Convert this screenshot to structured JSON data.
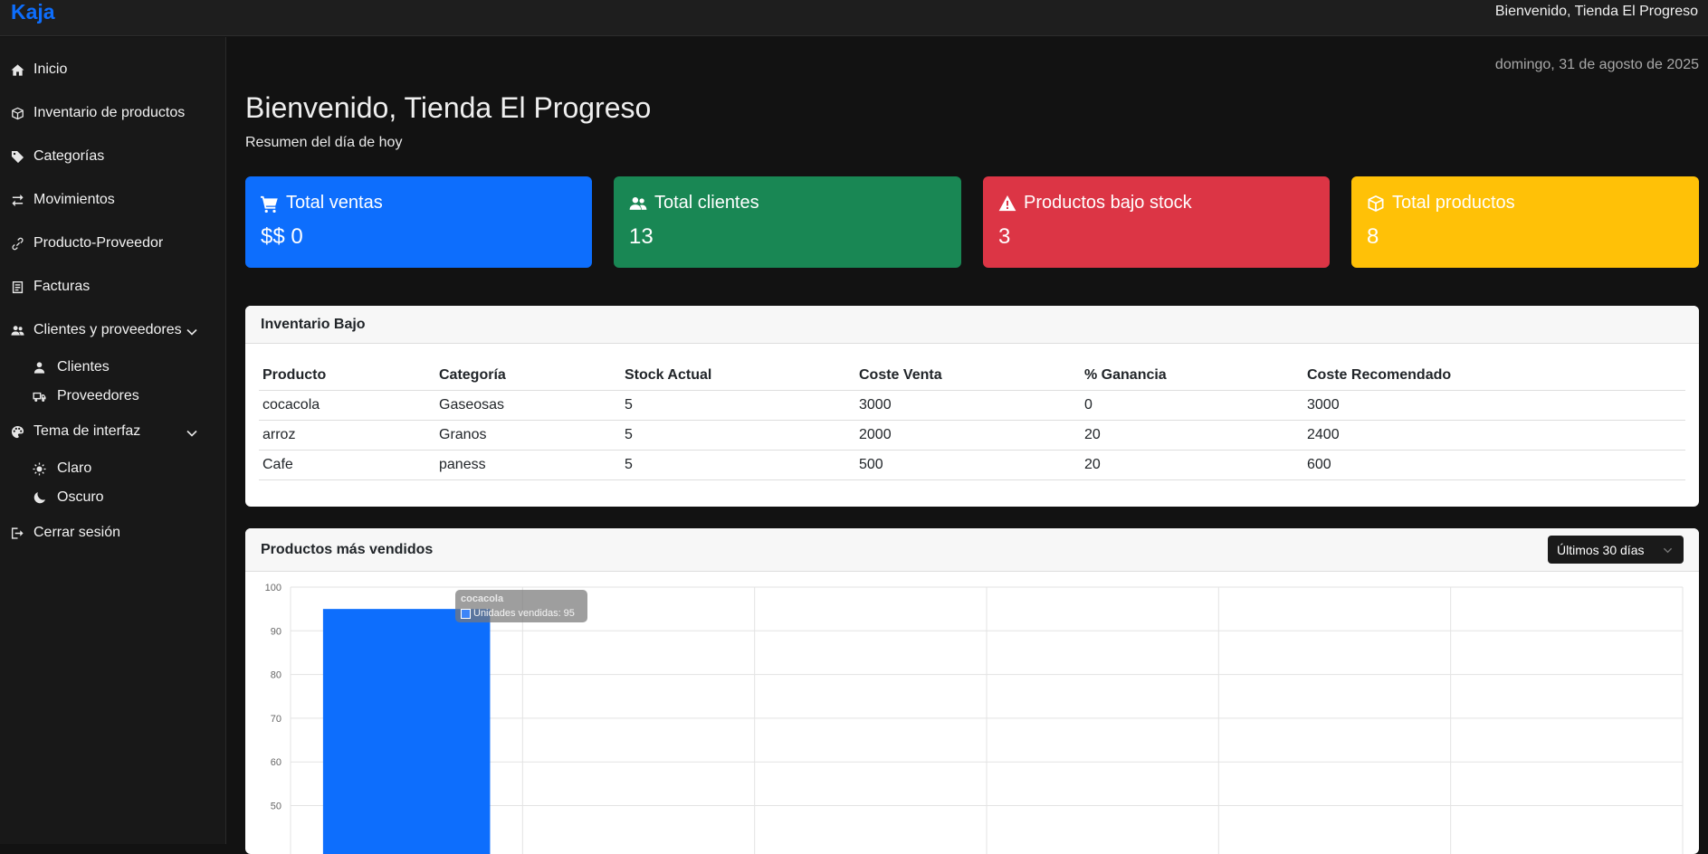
{
  "topbar": {
    "brand": "Kaja",
    "welcome": "Bienvenido, Tienda El Progreso"
  },
  "sidebar": {
    "items": [
      {
        "label": "Inicio",
        "icon": "home-icon"
      },
      {
        "label": "Inventario de productos",
        "icon": "box-icon"
      },
      {
        "label": "Categorías",
        "icon": "tag-icon"
      },
      {
        "label": "Movimientos",
        "icon": "arrows-icon"
      },
      {
        "label": "Producto-Proveedor",
        "icon": "link-icon"
      },
      {
        "label": "Facturas",
        "icon": "receipt-icon"
      },
      {
        "label": "Clientes y proveedores",
        "icon": "users-icon"
      },
      {
        "label": "Tema de interfaz",
        "icon": "palette-icon"
      },
      {
        "label": "Cerrar sesión",
        "icon": "logout-icon"
      }
    ],
    "clientes_sub": [
      {
        "label": "Clientes",
        "icon": "user-icon"
      },
      {
        "label": "Proveedores",
        "icon": "truck-icon"
      }
    ],
    "tema_sub": [
      {
        "label": "Claro",
        "icon": "sun-icon"
      },
      {
        "label": "Oscuro",
        "icon": "moon-icon"
      }
    ]
  },
  "main": {
    "date": "domingo, 31 de agosto de 2025",
    "title": "Bienvenido, Tienda El Progreso",
    "subtitle": "Resumen del día de hoy"
  },
  "cards": [
    {
      "label": "Total ventas",
      "value": "$$ 0",
      "color": "#0d6efd",
      "icon": "cart-icon"
    },
    {
      "label": "Total clientes",
      "value": "13",
      "color": "#198754",
      "icon": "users-icon"
    },
    {
      "label": "Productos bajo stock",
      "value": "3",
      "color": "#dc3545",
      "icon": "warning-icon"
    },
    {
      "label": "Total productos",
      "value": "8",
      "color": "#ffc107",
      "icon": "box-icon"
    }
  ],
  "low_inventory": {
    "title": "Inventario Bajo",
    "headers": [
      "Producto",
      "Categoría",
      "Stock Actual",
      "Coste Venta",
      "% Ganancia",
      "Coste Recomendado"
    ],
    "rows": [
      [
        "cocacola",
        "Gaseosas",
        "5",
        "3000",
        "0",
        "3000"
      ],
      [
        "arroz",
        "Granos",
        "5",
        "2000",
        "20",
        "2400"
      ],
      [
        "Cafe",
        "paness",
        "5",
        "500",
        "20",
        "600"
      ]
    ]
  },
  "top_products": {
    "title": "Productos más vendidos",
    "range_select": "Últimos 30 días",
    "tooltip": {
      "title": "cocacola",
      "label": "Unidades vendidas: 95"
    }
  },
  "chart_data": {
    "type": "bar",
    "categories": [
      "cocacola",
      "",
      "",
      "",
      "",
      ""
    ],
    "series": [
      {
        "name": "Unidades vendidas",
        "values": [
          95
        ]
      }
    ],
    "yticks": [
      100,
      90,
      80,
      70,
      60,
      50
    ],
    "ylim": [
      50,
      100
    ],
    "grid": true,
    "bar_color": "#0d6efd"
  }
}
